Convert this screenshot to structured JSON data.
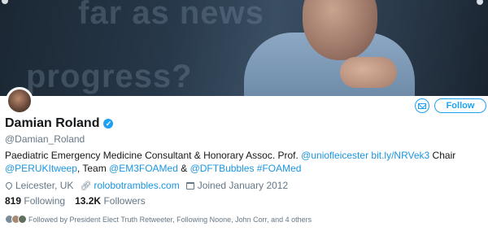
{
  "banner": {
    "line1": "far as news",
    "line2": "progress?"
  },
  "profile": {
    "display_name": "Damian Roland",
    "verified_glyph": "✓",
    "handle": "@Damian_Roland",
    "bio_line1": {
      "text": "Paediatric Emergency Medicine Consultant & Honorary Assoc. Prof. ",
      "mention1": "@uniofleicester",
      "link1": "bit.ly/NRVek3",
      "tail": " Chair"
    },
    "bio_line2": {
      "mention2": "@PERUKItweep",
      "mid1": ", Team ",
      "mention3": "@EM3FOAMed",
      "mid2": " & ",
      "mention4": "@DFTBubbles",
      "hashtag": "#FOAMed"
    },
    "location": "Leicester, UK",
    "website": "rolobotrambles.com",
    "joined": "Joined January 2012",
    "following_count": "819",
    "following_label": "Following",
    "followers_count": "13.2K",
    "followers_label": "Followers",
    "followed_by": "Followed by President Elect Truth Retweeter, Following Noone, John Corr, and 4 others"
  },
  "actions": {
    "follow_label": "Follow"
  },
  "icons": {
    "location": "location-pin-icon",
    "website": "link-icon",
    "joined": "calendar-icon",
    "message": "envelope-icon",
    "verified": "verified-badge-icon"
  },
  "colors": {
    "accent": "#1da1f2",
    "link": "#1b95e0",
    "text": "#14171a",
    "muted": "#657786"
  }
}
